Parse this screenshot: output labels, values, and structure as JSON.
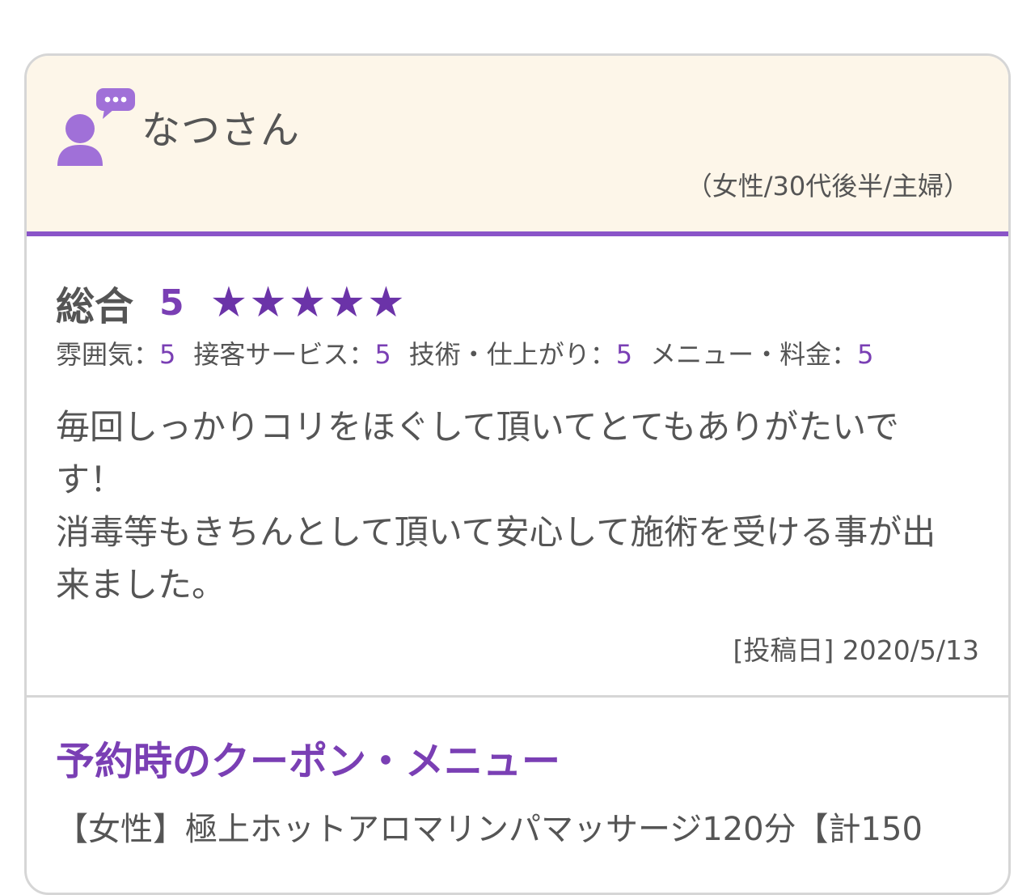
{
  "reviewer": {
    "name": "なつさん",
    "profile": "（女性/30代後半/主婦）",
    "icon": "person-speech-bubble-icon"
  },
  "rating": {
    "overall_label": "総合",
    "overall_score": "5",
    "stars": 5,
    "star_glyph": "★",
    "items": [
      {
        "label": "雰囲気：",
        "value": "5"
      },
      {
        "label": "接客サービス：",
        "value": "5"
      },
      {
        "label": "技術・仕上がり：",
        "value": "5"
      },
      {
        "label": "メニュー・料金：",
        "value": "5"
      }
    ]
  },
  "comment": "毎回しっかりコリをほぐして頂いてとてもありがたいです！\n消毒等もきちんとして頂いて安心して施術を受ける事が出来ました。",
  "post_date": "[投稿日] 2020/5/13",
  "coupon": {
    "title": "予約時のクーポン・メニュー",
    "text": "【女性】極上ホットアロマリンパマッサージ120分【計150"
  },
  "colors": {
    "accent": "#7a3fb4",
    "header_bg": "#fdf6e9",
    "avatar": "#a070d8",
    "text": "#555555"
  }
}
